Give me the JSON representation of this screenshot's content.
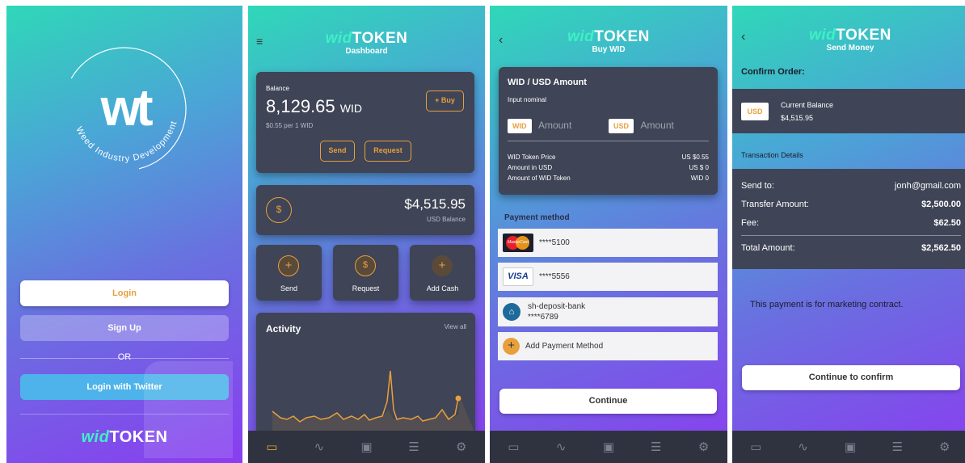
{
  "brand": {
    "wid": "wid",
    "token": "TOKEN"
  },
  "screen1": {
    "logo_text": "Weed Industry Development",
    "login": "Login",
    "signup": "Sign Up",
    "or": "OR",
    "twitter": "Login with Twitter"
  },
  "screen2": {
    "subtitle": "Dashboard",
    "balance_label": "Balance",
    "balance_value": "8,129.65",
    "balance_unit": "WID",
    "rate": "$0.55 per 1 WID",
    "buy": "+ Buy",
    "send": "Send",
    "request": "Request",
    "usd_value": "$4,515.95",
    "usd_label": "USD Balance",
    "actions": [
      {
        "label": "Send"
      },
      {
        "label": "Request"
      },
      {
        "label": "Add Cash"
      }
    ],
    "activity_title": "Activity",
    "view_all": "View all"
  },
  "screen3": {
    "subtitle": "Buy WID",
    "card_title": "WID / USD Amount",
    "input_nominal": "Input nominal",
    "wid_badge": "WID",
    "usd_badge": "USD",
    "amount_placeholder": "Amount",
    "rows": [
      {
        "label": "WID Token Price",
        "value": "US $0.55"
      },
      {
        "label": "Amount in USD",
        "value": "US $ 0"
      },
      {
        "label": "Amount of WID Token",
        "value": "WID 0"
      }
    ],
    "payment_method": "Payment method",
    "mastercard_label": "MasterCard",
    "mastercard_number": "****5100",
    "visa_label": "VISA",
    "visa_number": "****5556",
    "bank_name": "sh-deposit-bank",
    "bank_number": "****6789",
    "add_method": "Add Payment Method",
    "continue": "Continue"
  },
  "screen4": {
    "subtitle": "Send Money",
    "confirm_order": "Confirm Order:",
    "usd_badge": "USD",
    "current_balance": "Current Balance",
    "current_balance_value": "$4,515.95",
    "transaction_details": "Transaction Details",
    "send_to_label": "Send to:",
    "send_to_value": "jonh@gmail.com",
    "transfer_label": "Transfer Amount:",
    "transfer_value": "$2,500.00",
    "fee_label": "Fee:",
    "fee_value": "$62.50",
    "total_label": "Total Amount:",
    "total_value": "$2,562.50",
    "note": "This payment is for marketing contract.",
    "continue_confirm": "Continue to confirm"
  },
  "icons": [
    "menu-icon",
    "back-icon",
    "wallet-icon",
    "pulse-icon",
    "cash-icon",
    "list-icon",
    "settings-icon",
    "plus-icon",
    "dollar-icon",
    "bank-icon"
  ],
  "colors": {
    "accent": "#e8a03c",
    "teal": "#3ff0c4",
    "card": "#3f4456",
    "tabbar": "#2f3340",
    "twitter": "#4db3ea"
  }
}
